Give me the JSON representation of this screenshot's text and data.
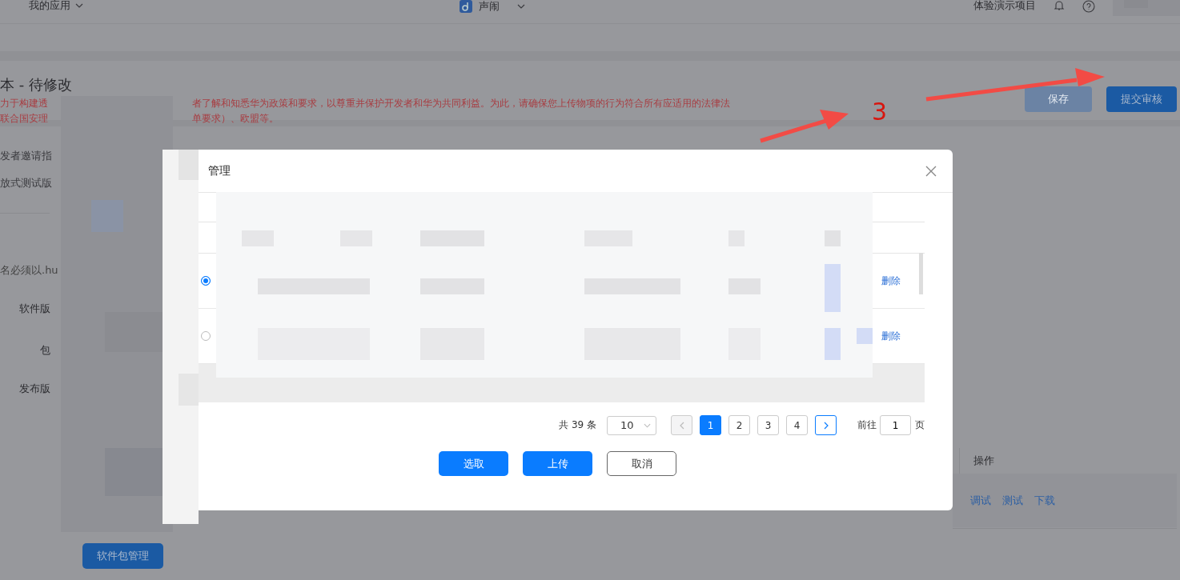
{
  "top_bar": {
    "app_menu": "我的应用",
    "app_name": "声闹",
    "project": "体验演示项目"
  },
  "header": {
    "title": "本 - 待修改",
    "notice_lines": [
      {
        "before": "力于构建透",
        "after": "者了解和知悉华为政策和要求，以尊重并保护开发者和华为共同利益。为此，请确保您上传物项的行为符合所有应适用的法律法"
      },
      {
        "before": "联合国安理",
        "after": "单要求）、欧盟等。"
      }
    ],
    "buttons": [
      {
        "label": "保存",
        "disabled": true
      },
      {
        "label": "提交审核",
        "disabled": false
      }
    ]
  },
  "test_section": {
    "lines": [
      "发者邀请指",
      "放式测试版"
    ]
  },
  "package_section": {
    "hint": "名必须以.hu",
    "fields": [
      "软件版",
      "包",
      "发布版"
    ]
  },
  "package_table": {
    "columns": [
      "操作"
    ],
    "actions": [
      "调试",
      "测试",
      "下载"
    ]
  },
  "package_button": "软件包管理",
  "dialog": {
    "title": "管理",
    "rows": [
      {
        "selected": true,
        "action": "删除"
      },
      {
        "selected": false,
        "action": "删除"
      }
    ],
    "pagination": {
      "total": "共 39 条",
      "page_size": "10",
      "prev_disabled": true,
      "pages": [
        {
          "label": "1",
          "selected": true
        },
        {
          "label": "2",
          "selected": false
        },
        {
          "label": "3",
          "selected": false
        },
        {
          "label": "4",
          "selected": false
        }
      ],
      "goto_label": "前往",
      "goto_value": "1",
      "goto_suffix": "页"
    },
    "buttons": [
      {
        "label": "选取",
        "kind": "primary"
      },
      {
        "label": "上传",
        "kind": "primary"
      },
      {
        "label": "取消",
        "kind": "plain"
      }
    ]
  },
  "annotation": {
    "number": "3"
  }
}
